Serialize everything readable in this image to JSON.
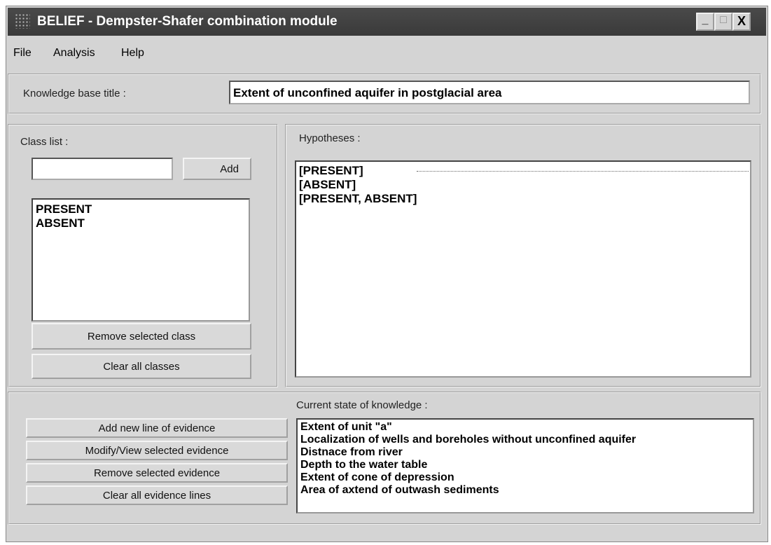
{
  "window": {
    "title": "BELIEF - Dempster-Shafer combination module",
    "controls": {
      "minimize": "_",
      "maximize": "□",
      "close": "X"
    }
  },
  "menu": {
    "items": [
      "File",
      "Analysis",
      "Help"
    ]
  },
  "kb": {
    "label": "Knowledge base title :",
    "value": "Extent of unconfined aquifer in postglacial area"
  },
  "classlist": {
    "label": "Class list :",
    "input_value": "",
    "add_label": "Add",
    "items": [
      "PRESENT",
      "ABSENT"
    ],
    "remove_label": "Remove selected class",
    "clear_label": "Clear all classes"
  },
  "hypotheses": {
    "label": "Hypotheses :",
    "items": [
      "[PRESENT]",
      "[ABSENT]",
      "[PRESENT, ABSENT]"
    ]
  },
  "evidence": {
    "buttons": [
      "Add new line of evidence",
      "Modify/View selected evidence",
      "Remove selected evidence",
      "Clear all evidence lines"
    ]
  },
  "knowledge": {
    "label": "Current state of knowledge :",
    "items": [
      "Extent of unit \"a\"",
      "Localization of wells and boreholes without unconfined aquifer",
      "Distnace from river",
      "Depth to the water table",
      "Extent of cone of depression",
      "Area of axtend of outwash sediments"
    ]
  }
}
